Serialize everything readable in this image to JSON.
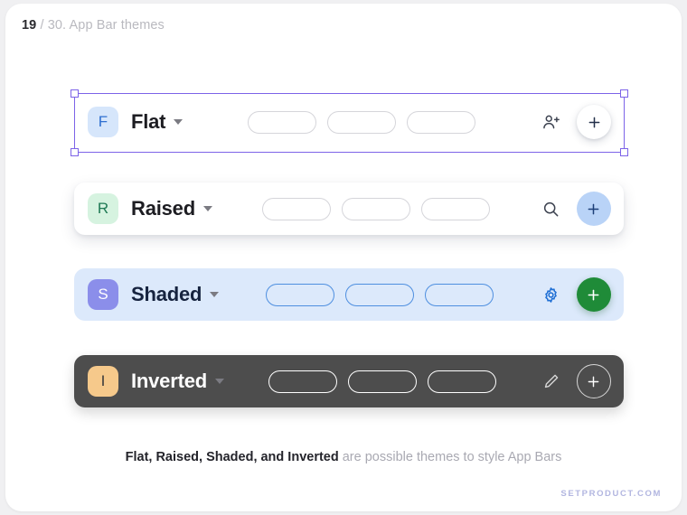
{
  "header": {
    "number": "19",
    "rest": " / 30. App Bar themes"
  },
  "bars": [
    {
      "key": "flat",
      "avatar_letter": "F",
      "avatar_bg": "#d6e6fb",
      "avatar_fg": "#2f6fd0",
      "title": "Flat",
      "title_color": "#1d1d22",
      "bar_bg": "#ffffff",
      "chip_border": "#d5d5da",
      "action_icon": "person-add-icon",
      "action_icon_color": "#3c4250",
      "fab_label": "+",
      "fab_bg": "#ffffff",
      "fab_fg": "#23304a",
      "selected": true
    },
    {
      "key": "raised",
      "avatar_letter": "R",
      "avatar_bg": "#d6f3e0",
      "avatar_fg": "#1f7a55",
      "title": "Raised",
      "title_color": "#1d1d22",
      "bar_bg": "#ffffff",
      "chip_border": "#d5d5da",
      "action_icon": "search-icon",
      "action_icon_color": "#3c4250",
      "fab_label": "+",
      "fab_bg": "#b9d3f7",
      "fab_fg": "#1c3f78",
      "selected": false
    },
    {
      "key": "shaded",
      "avatar_letter": "S",
      "avatar_bg": "#8b8eea",
      "avatar_fg": "#ffffff",
      "title": "Shaded",
      "title_color": "#16233f",
      "bar_bg": "#dce9fb",
      "chip_border": "#4e8fe0",
      "action_icon": "gear-icon",
      "action_icon_color": "#1f6fd4",
      "fab_label": "+",
      "fab_bg": "#1f8b38",
      "fab_fg": "#ffffff",
      "selected": false
    },
    {
      "key": "inverted",
      "avatar_letter": "I",
      "avatar_bg": "#f6c98b",
      "avatar_fg": "#3a3a3a",
      "title": "Inverted",
      "title_color": "#ffffff",
      "bar_bg": "#4d4d4d",
      "chip_border": "#ffffff",
      "action_icon": "pencil-icon",
      "action_icon_color": "#d6d6d6",
      "fab_label": "+",
      "fab_bg": "transparent",
      "fab_fg": "#ffffff",
      "selected": false
    }
  ],
  "caption": {
    "strong": "Flat, Raised, Shaded, and Inverted",
    "muted": " are possible themes to style App Bars"
  },
  "footer": {
    "brand": "SETPRODUCT.COM"
  },
  "colors": {
    "selection": "#7c63e8",
    "page_bg": "#f0f0f2",
    "card_bg": "#ffffff"
  }
}
